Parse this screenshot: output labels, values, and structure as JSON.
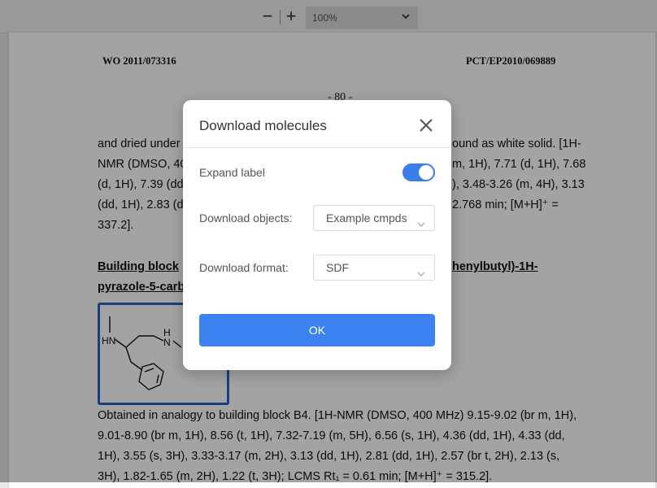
{
  "toolbar": {
    "zoom_out": "−",
    "zoom_in": "+",
    "zoom_level": "100%"
  },
  "document": {
    "header_left": "WO 2011/073316",
    "header_right": "PCT/EP2010/069889",
    "page_number": "- 80 -",
    "lines": [
      "and dried under",
      "NMR (DMSO, 40",
      "(d, 1H), 7.39 (dd",
      "(dd, 1H), 2.83 (d",
      "337.2]."
    ],
    "lines_right": [
      "ound as white solid. [1H-",
      "m, 1H), 7.71 (d, 1H), 7.68",
      "), 3.48-3.26 (m, 4H), 3.13",
      "2.768 min; [M+H]⁺ ="
    ],
    "section_left_1": "Building block",
    "section_left_2": "pyrazole-5-carb",
    "section_right_1": "henylbutyl)-1H-",
    "paragraph": [
      "Obtained in analogy to building block B4. [1H-NMR (DMSO, 400 MHz) 9.15-9.02 (br m, 1H),",
      "9.01-8.90 (br m, 1H), 8.56 (t, 1H), 7.32-7.19 (m, 5H), 6.56 (s, 1H), 4.36 (dd, 1H), 4.33 (dd,",
      "1H), 3.55 (s, 3H), 3.33-3.17 (m, 2H), 3.13 (dd, 1H), 2.81 (dd, 1H), 2.57 (br t, 2H), 2.13 (s,",
      "3H), 1.82-1.65 (m, 2H), 1.22 (t, 3H); LCMS Rt₁ = 0.61 min; [M+H]⁺ = 315.2]."
    ],
    "structure_atoms": {
      "n1": "HN",
      "n2": "H",
      "n3": "N"
    }
  },
  "modal": {
    "title": "Download molecules",
    "expand_label": "Expand label",
    "expand_on": true,
    "objects_label": "Download objects:",
    "objects_value": "Example cmpds",
    "format_label": "Download format:",
    "format_value": "SDF",
    "ok_label": "OK",
    "accent_color": "#3b82f0"
  }
}
